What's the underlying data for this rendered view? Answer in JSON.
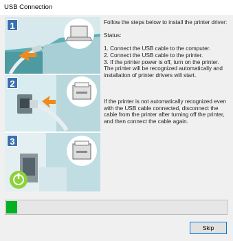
{
  "window": {
    "title": "USB Connection"
  },
  "steps": [
    {
      "number": "1",
      "icon": "usb-cable-computer"
    },
    {
      "number": "2",
      "icon": "usb-cable-printer"
    },
    {
      "number": "3",
      "icon": "power-button"
    }
  ],
  "instructions": {
    "intro": "Follow the steps below to install the printer driver:",
    "status_label": "Status:",
    "step_lines": [
      "1. Connect the USB cable to the computer.",
      "2. Connect the USB cable to the printer.",
      "3. If the printer power is off, turn on the printer.",
      "The printer will be recognized automatically and installation of printer drivers will start."
    ],
    "note": "If the printer is not automatically recognized even with the USB cable connected, disconnect the cable from the printer after turning off the printer, and then connect the cable again."
  },
  "progress": {
    "fraction": 0.05,
    "color": "#06b025"
  },
  "buttons": {
    "skip": "Skip"
  },
  "colors": {
    "step_badge": "#3a6fb0",
    "accent": "#0078d7",
    "arrow": "#f08a1c",
    "power": "#8cd23a"
  }
}
